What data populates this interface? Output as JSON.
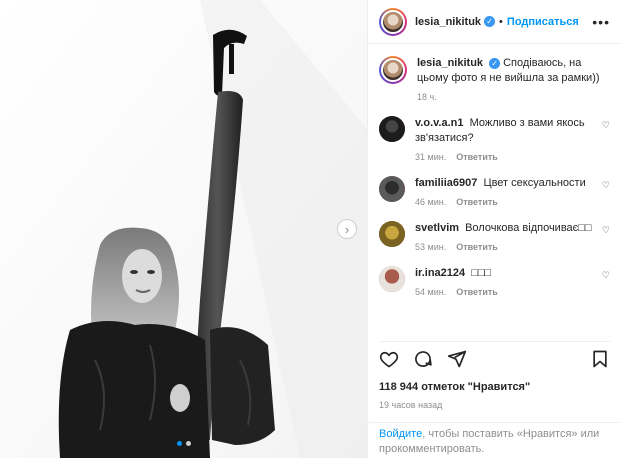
{
  "post": {
    "author": "lesia_nikituk",
    "follow_label": "Подписаться",
    "more_icon": "more-icon",
    "separator": "•"
  },
  "caption": {
    "user": "lesia_nikituk",
    "text": "Сподіваюсь, на цьому фото я не вийшла за рамки))",
    "time": "18 ч."
  },
  "comments": [
    {
      "user": "v.o.v.a.n1",
      "text": "Можливо з вами якось зв'язатися?",
      "time": "31 мин.",
      "reply": "Ответить"
    },
    {
      "user": "familiia6907",
      "text": "Цвет сексуальности",
      "time": "46 мин.",
      "reply": "Ответить"
    },
    {
      "user": "svetlvim",
      "text": "Волочкова відпочиває□□",
      "time": "53 мин.",
      "reply": "Ответить"
    },
    {
      "user": "ir.ina2124",
      "text": "□□□",
      "time": "54 мин.",
      "reply": "Ответить"
    }
  ],
  "stats": {
    "likes": "118 944 отметок \"Нравится\"",
    "posted": "19 часов назад"
  },
  "login_prompt": {
    "link": "Войдите",
    "rest": ", чтобы поставить «Нравится» или прокомментировать."
  },
  "carousel": {
    "current": 1,
    "total": 2
  },
  "colors": {
    "accent": "#0095f6",
    "text": "#262626",
    "muted": "#8e8e8e"
  }
}
